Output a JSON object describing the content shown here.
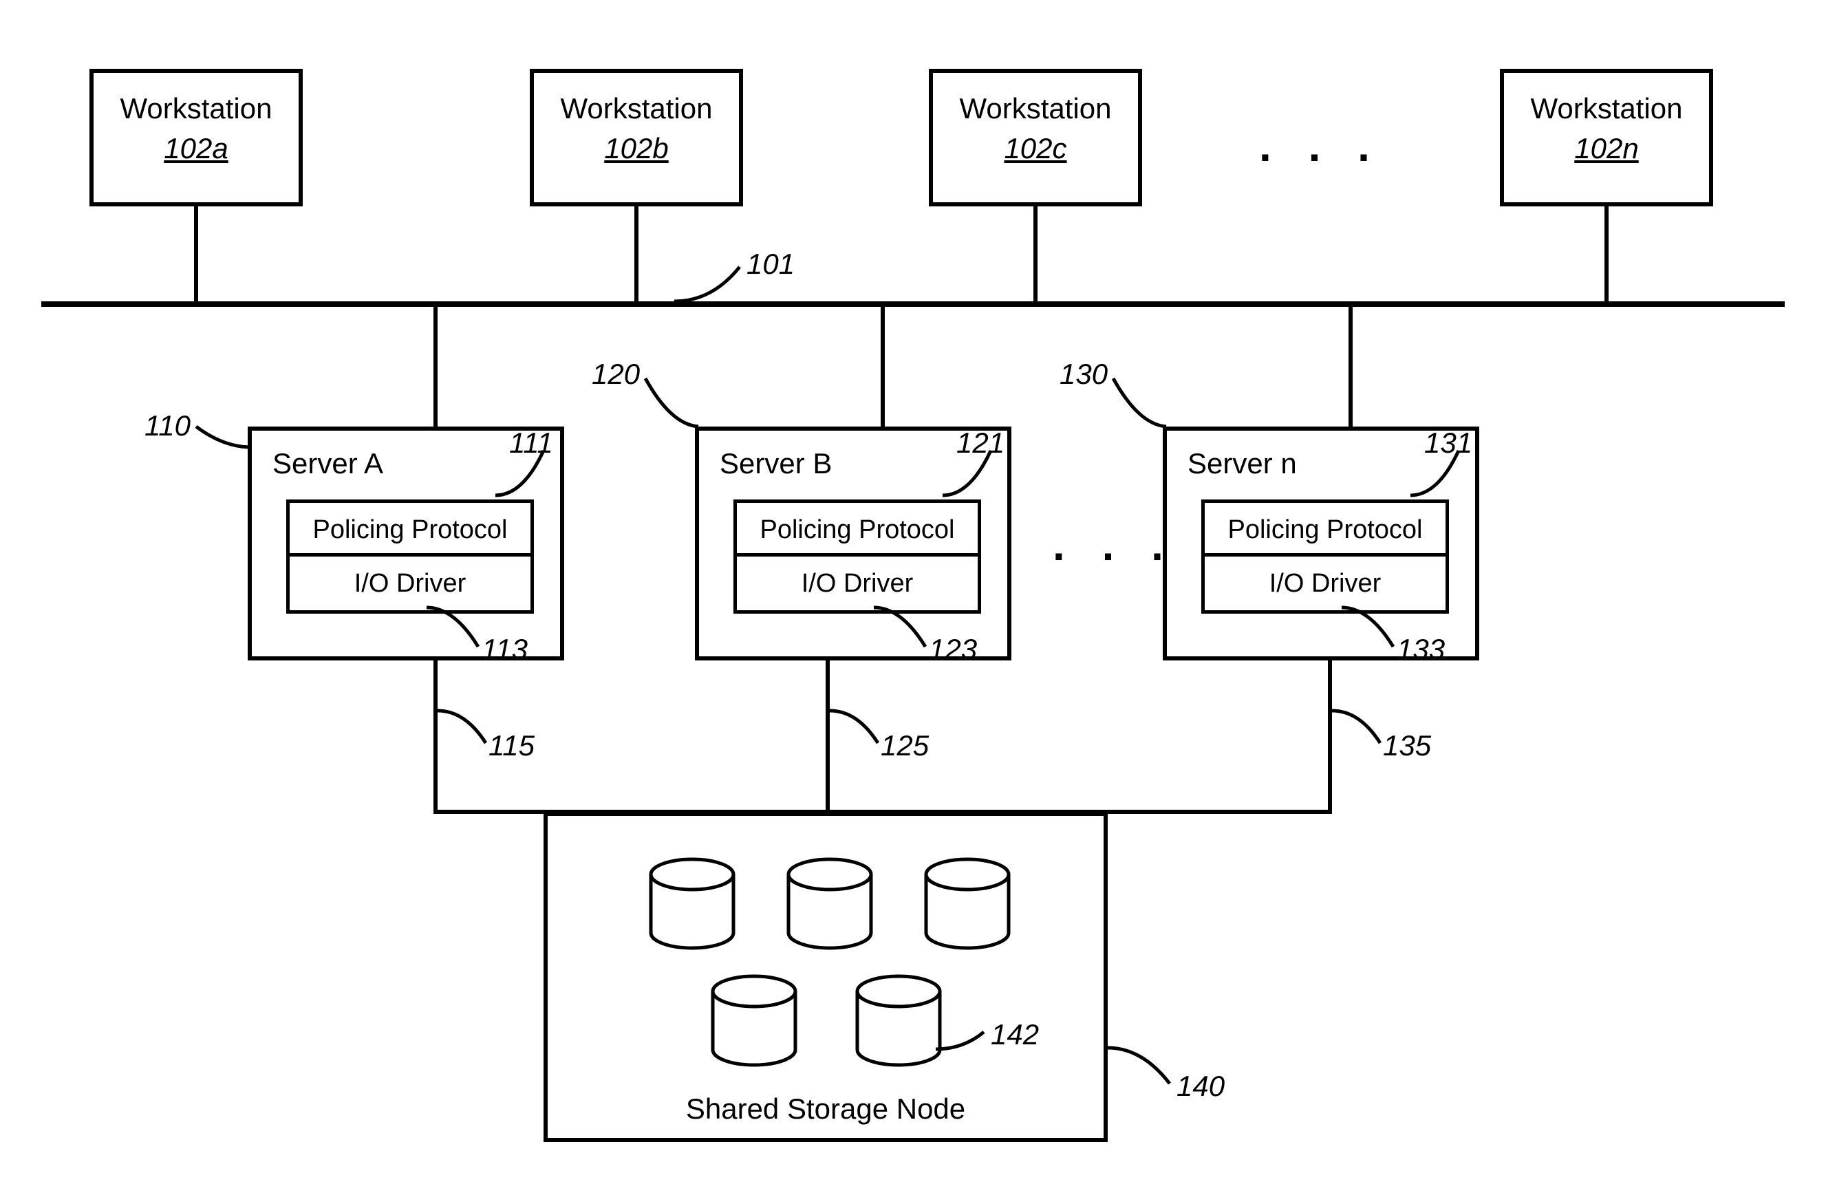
{
  "workstations": [
    {
      "label": "Workstation",
      "ref": "102a"
    },
    {
      "label": "Workstation",
      "ref": "102b"
    },
    {
      "label": "Workstation",
      "ref": "102c"
    },
    {
      "label": "Workstation",
      "ref": "102n"
    }
  ],
  "bus_ref": "101",
  "servers": [
    {
      "title": "Server A",
      "ref_box": "110",
      "ref_pp": "111",
      "ref_io": "113",
      "ref_line": "115",
      "policing": "Policing Protocol",
      "io": "I/O Driver"
    },
    {
      "title": "Server B",
      "ref_box": "120",
      "ref_pp": "121",
      "ref_io": "123",
      "ref_line": "125",
      "policing": "Policing Protocol",
      "io": "I/O Driver"
    },
    {
      "title": "Server n",
      "ref_box": "130",
      "ref_pp": "131",
      "ref_io": "133",
      "ref_line": "135",
      "policing": "Policing Protocol",
      "io": "I/O Driver"
    }
  ],
  "storage": {
    "title": "Shared Storage Node",
    "ref": "140",
    "drive_ref": "142"
  },
  "ellipsis": ". . ."
}
